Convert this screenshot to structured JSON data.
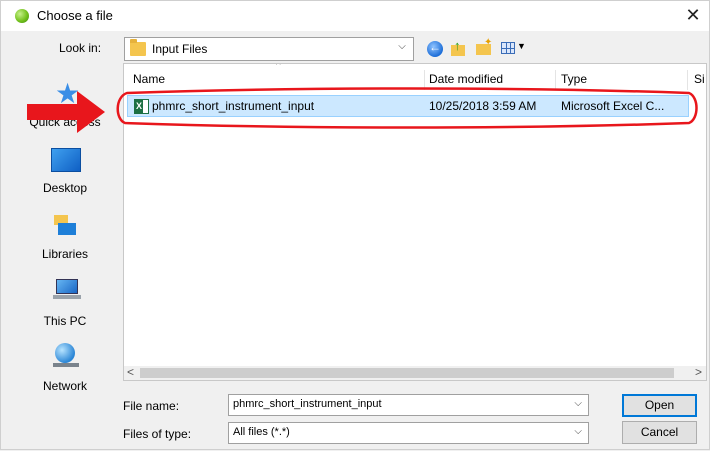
{
  "window": {
    "title": "Choose a file",
    "close_glyph": "✕"
  },
  "toolbar": {
    "look_in_label": "Look in:",
    "look_in_value": "Input Files",
    "dropdown_glyph": "⌵"
  },
  "places": [
    {
      "icon": "quick-access-icon",
      "label": "Quick access"
    },
    {
      "icon": "desktop-icon",
      "label": "Desktop"
    },
    {
      "icon": "libraries-icon",
      "label": "Libraries"
    },
    {
      "icon": "this-pc-icon",
      "label": "This PC"
    },
    {
      "icon": "network-icon",
      "label": "Network"
    }
  ],
  "file_list": {
    "columns": [
      "Name",
      "Date modified",
      "Type",
      "Si"
    ],
    "rows": [
      {
        "name": "phmrc_short_instrument_input",
        "date_modified": "10/25/2018 3:59 AM",
        "type": "Microsoft Excel C...",
        "icon": "excel-csv-icon",
        "selected": true
      }
    ],
    "scroll_left": "<",
    "scroll_right": ">"
  },
  "footer": {
    "file_name_label": "File name:",
    "file_name_value": "phmrc_short_instrument_input",
    "files_of_type_label": "Files of type:",
    "files_of_type_value": "All files (*.*)",
    "open_label": "Open",
    "cancel_label": "Cancel"
  },
  "colors": {
    "selection_bg": "#cce8ff",
    "annotation_red": "#e8161c",
    "default_button_border": "#0078d7"
  }
}
